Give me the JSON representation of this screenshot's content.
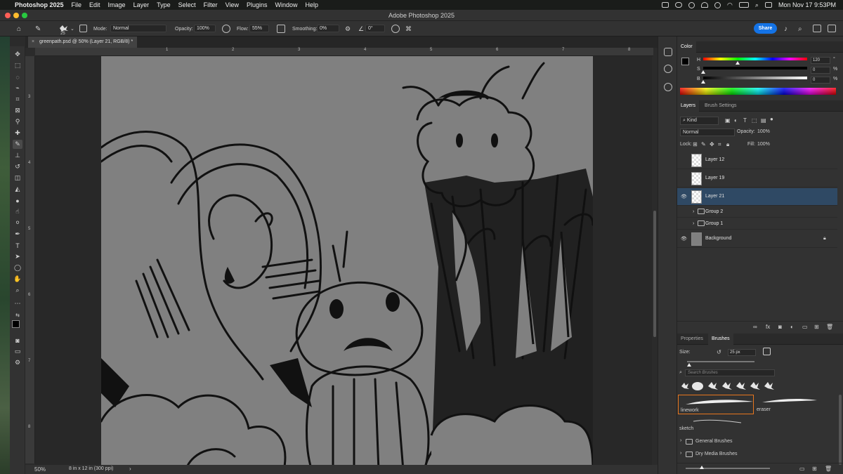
{
  "menubar": {
    "app": "Photoshop 2025",
    "items": [
      "File",
      "Edit",
      "Image",
      "Layer",
      "Type",
      "Select",
      "Filter",
      "View",
      "Plugins",
      "Window",
      "Help"
    ],
    "datetime": "Mon Nov 17  9:53PM"
  },
  "window": {
    "title": "Adobe Photoshop 2025"
  },
  "options": {
    "brush_size": "25",
    "mode_label": "Mode:",
    "mode_value": "Normal",
    "opacity_label": "Opacity:",
    "opacity_value": "100%",
    "flow_label": "Flow:",
    "flow_value": "55%",
    "smoothing_label": "Smoothing:",
    "smoothing_value": "0%",
    "angle_value": "0°",
    "share_label": "Share"
  },
  "document": {
    "tab_title": "greenpath.psd @ 50% (Layer 21, RGB/8) *",
    "ruler_top": [
      "1",
      "2",
      "3",
      "4",
      "5",
      "6",
      "7",
      "8"
    ],
    "ruler_left": [
      "3",
      "4",
      "5",
      "6",
      "7",
      "8",
      "9"
    ],
    "zoom": "50%",
    "doc_info": "8 in x 12 in (300 ppi)"
  },
  "color_panel": {
    "title": "Color",
    "h_label": "H",
    "s_label": "S",
    "b_label": "B",
    "h_value": "120",
    "s_value": "0",
    "b_value": "0",
    "h_unit": "°",
    "s_unit": "%",
    "b_unit": "%",
    "h_fraction": 0.33,
    "s_fraction": 0,
    "b_fraction": 0
  },
  "layers_panel": {
    "tab_layers": "Layers",
    "tab_brush_settings": "Brush Settings",
    "kind_label": "Kind",
    "blend_mode": "Normal",
    "opacity_label": "Opacity:",
    "opacity_value": "100%",
    "lock_label": "Lock:",
    "fill_label": "Fill:",
    "fill_value": "100%",
    "layers": [
      {
        "name": "Layer 12",
        "visible": false
      },
      {
        "name": "Layer 19",
        "visible": false
      },
      {
        "name": "Layer 21",
        "visible": true,
        "selected": true
      },
      {
        "name": "Group 2",
        "visible": false,
        "group": true
      },
      {
        "name": "Group 1",
        "visible": false,
        "group": true
      },
      {
        "name": "Background",
        "visible": true,
        "locked": true
      }
    ]
  },
  "brushes_panel": {
    "tab_properties": "Properties",
    "tab_brushes": "Brushes",
    "size_label": "Size:",
    "size_value": "25 px",
    "search_placeholder": "Search Brushes",
    "presets": [
      "linework",
      "eraser",
      "sketch"
    ],
    "folders": [
      "General Brushes",
      "Dry Media Brushes"
    ]
  },
  "colors": {
    "accent": "#1473e6",
    "selection": "#2f4964",
    "canvas": "#808080",
    "brush_highlight": "#e8761e"
  }
}
